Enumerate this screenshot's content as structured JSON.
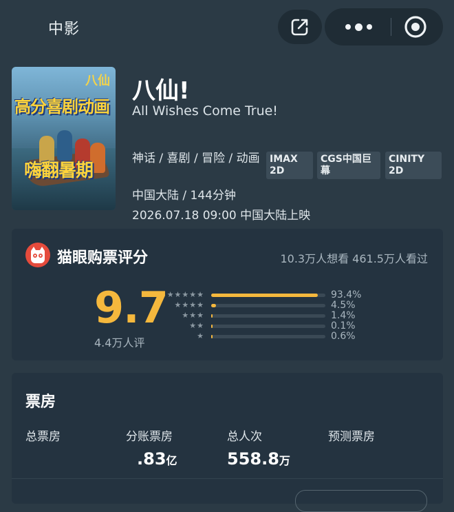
{
  "topbar": {
    "back_label": "中影",
    "icons": {
      "share": "share-icon",
      "more": "more-dots-icon",
      "close": "target-close-icon"
    }
  },
  "movie": {
    "title": "八仙!",
    "english_title": "All Wishes Come True!",
    "genres": "神话 / 喜剧 / 冒险 / 动画",
    "badges": [
      "IMAX 2D",
      "CGS中国巨幕",
      "CINITY 2D"
    ],
    "region_runtime": "中国大陆 / 144分钟",
    "release": "2026.07.18 09:00 中国大陆上映",
    "poster": {
      "logo_text": "八仙",
      "tagline_top": "高分喜剧动画",
      "tagline_bottom": "嗨翻暑期"
    }
  },
  "rating": {
    "title": "猫眼购票评分",
    "stats": "10.3万人想看 461.5万人看过",
    "score": "9.7",
    "count": "4.4万人评",
    "distribution": [
      {
        "stars": "★★★★★",
        "percent_label": "93.4%",
        "fraction": 0.934
      },
      {
        "stars": "★★★★",
        "percent_label": "4.5%",
        "fraction": 0.045
      },
      {
        "stars": "★★★",
        "percent_label": "1.4%",
        "fraction": 0.014
      },
      {
        "stars": "★★",
        "percent_label": "0.1%",
        "fraction": 0.001
      },
      {
        "stars": "★",
        "percent_label": "0.6%",
        "fraction": 0.006
      }
    ],
    "colors": {
      "accent": "#f5b83d",
      "logo": "#e54b3c"
    }
  },
  "box_office": {
    "title": "票房",
    "columns": [
      {
        "label": "总票房",
        "value": "",
        "unit": ""
      },
      {
        "label": "分账票房",
        "value": ".83",
        "unit": "亿"
      },
      {
        "label": "总人次",
        "value": "558.8",
        "unit": "万"
      },
      {
        "label": "预测票房",
        "value": "",
        "unit": ""
      }
    ]
  }
}
